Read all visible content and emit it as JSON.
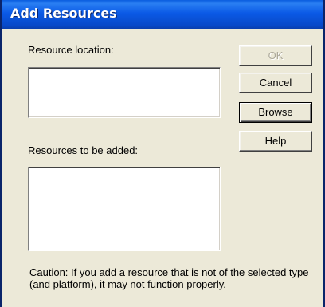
{
  "window": {
    "title": "Add Resources"
  },
  "labels": {
    "resource_location": "Resource location:",
    "resources_to_be_added": "Resources to be added:"
  },
  "buttons": {
    "ok": "OK",
    "cancel": "Cancel",
    "browse": "Browse",
    "help": "Help"
  },
  "fields": {
    "resource_location_value": "",
    "resources_to_be_added_value": ""
  },
  "caution_text": "Caution: If you add a resource that is not of the selected type (and platform), it may not function properly."
}
